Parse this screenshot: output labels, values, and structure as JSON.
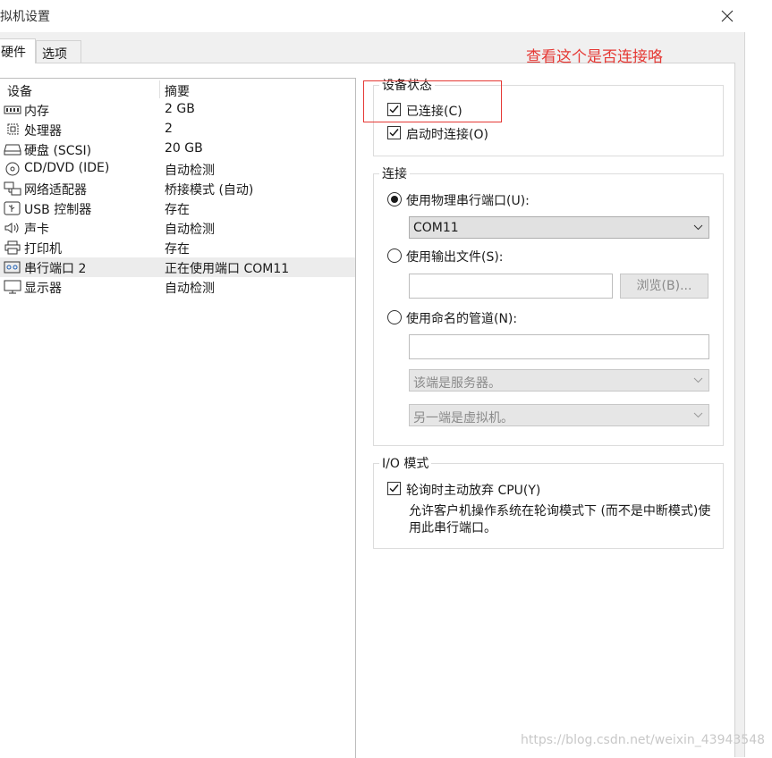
{
  "window": {
    "title": "拟机设置",
    "tabs": [
      "硬件",
      "选项"
    ]
  },
  "device_list": {
    "headers": {
      "device": "设备",
      "summary": "摘要"
    },
    "rows": [
      {
        "icon": "memory-icon",
        "name": "内存",
        "summary": "2 GB"
      },
      {
        "icon": "cpu-icon",
        "name": "处理器",
        "summary": "2"
      },
      {
        "icon": "hard-disk-icon",
        "name": "硬盘 (SCSI)",
        "summary": "20 GB"
      },
      {
        "icon": "cd-dvd-icon",
        "name": "CD/DVD (IDE)",
        "summary": "自动检测"
      },
      {
        "icon": "network-adapter-icon",
        "name": "网络适配器",
        "summary": "桥接模式 (自动)"
      },
      {
        "icon": "usb-icon",
        "name": "USB 控制器",
        "summary": "存在"
      },
      {
        "icon": "speaker-icon",
        "name": "声卡",
        "summary": "自动检测"
      },
      {
        "icon": "printer-icon",
        "name": "打印机",
        "summary": "存在"
      },
      {
        "icon": "serial-port-icon",
        "name": "串行端口 2",
        "summary": "正在使用端口 COM11"
      },
      {
        "icon": "monitor-icon",
        "name": "显示器",
        "summary": "自动检测"
      }
    ],
    "selected_index": 8
  },
  "device_status": {
    "label": "设备状态",
    "connected": {
      "label": "已连接(C)",
      "checked": true
    },
    "connect_at_power_on": {
      "label": "启动时连接(O)",
      "checked": true
    }
  },
  "connection": {
    "label": "连接",
    "physical_port": {
      "label": "使用物理串行端口(U):",
      "selected": true,
      "value": "COM11"
    },
    "output_file": {
      "label": "使用输出文件(S):",
      "selected": false,
      "browse_label": "浏览(B)..."
    },
    "named_pipe": {
      "label": "使用命名的管道(N):",
      "selected": false,
      "end_option": "该端是服务器。",
      "other_end_option": "另一端是虚拟机。"
    }
  },
  "io_mode": {
    "label": "I/O 模式",
    "yield_cpu": {
      "label": "轮询时主动放弃 CPU(Y)",
      "checked": true
    },
    "description": "允许客户机操作系统在轮询模式下 (而不是中断模式)使用此串行端口。"
  },
  "annotation": {
    "text": "查看这个是否连接咯",
    "color": "#e53935"
  },
  "watermark": "https://blog.csdn.net/weixin_43943548"
}
